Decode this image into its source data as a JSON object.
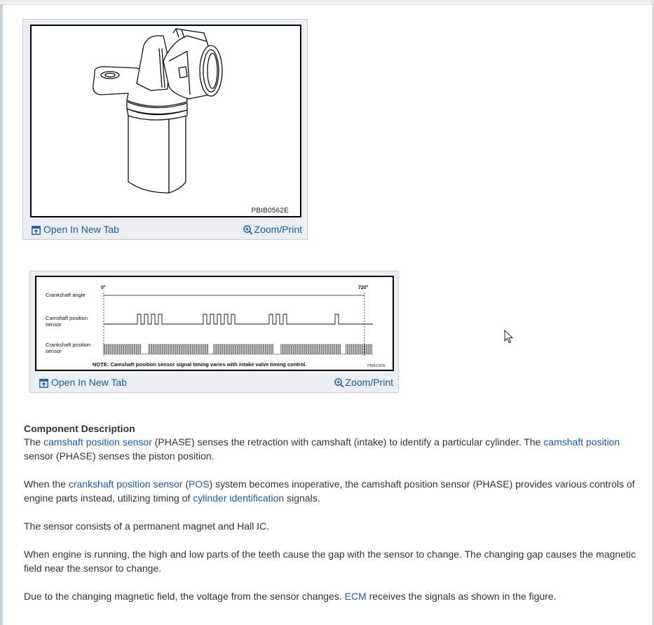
{
  "figure1": {
    "image_code": "PBIB0562E",
    "open_label": "Open In New Tab",
    "zoom_label": "Zoom/Print"
  },
  "figure2": {
    "angle_start": "0°",
    "angle_end": "720°",
    "row_labels": {
      "crank_angle": "Crankshaft angle",
      "camshaft": "Camshaft position sensor",
      "crankshaft": "Crankshaft position sensor"
    },
    "note": "NOTE: Camshaft position sensor signal timing varies with intake valve timing control.",
    "image_code": "PBIB2382E",
    "open_label": "Open In New Tab",
    "zoom_label": "Zoom/Print"
  },
  "article": {
    "heading": "Component Description",
    "p1": {
      "t1": "The ",
      "link1": "camshaft position sensor",
      "t2": " (PHASE) senses the retraction with camshaft (intake) to identify a particular cylinder. The ",
      "link2": "camshaft position",
      "t3": " sensor (PHASE) senses the piston position."
    },
    "p2": {
      "t1": "When the ",
      "link1": "crankshaft position sensor",
      "t2": " (",
      "link2": "POS",
      "t3": ") system becomes inoperative, the camshaft position sensor (PHASE) provides various controls of engine parts instead, utilizing timing of ",
      "link3": "cylinder identification",
      "t4": " signals."
    },
    "p3": "The sensor consists of a permanent magnet and Hall IC.",
    "p4": "When engine is running, the high and low parts of the teeth cause the gap with the sensor to change. The changing gap causes the magnetic field near the sensor to change.",
    "p5": {
      "t1": "Due to the changing magnetic field, the voltage from the sensor changes. ",
      "link1": "ECM",
      "t2": " receives the signals as shown in the figure."
    }
  },
  "icons": {
    "open": "open-in-new-tab-icon",
    "zoom": "zoom-in-icon",
    "cursor": "mouse-pointer-icon"
  },
  "colors": {
    "link": "#1d5aa0",
    "figure_bg": "#ebeef3",
    "text": "#333333"
  }
}
